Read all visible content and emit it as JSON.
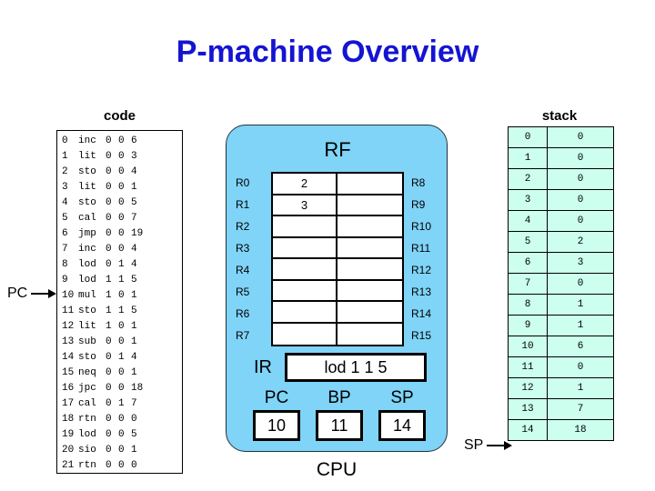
{
  "title": "P-machine Overview",
  "colors": {
    "title": "#1414d2",
    "cpu_panel": "#7FD4F7",
    "stack_cell": "#CCFFEE",
    "box_border": "#000000"
  },
  "code": {
    "label": "code",
    "pointer_label": "PC",
    "pointer_target_line": 10,
    "lines": [
      {
        "n": "0",
        "op": "inc",
        "a": "0",
        "b": "0",
        "c": "6"
      },
      {
        "n": "1",
        "op": "lit",
        "a": "0",
        "b": "0",
        "c": "3"
      },
      {
        "n": "2",
        "op": "sto",
        "a": "0",
        "b": "0",
        "c": "4"
      },
      {
        "n": "3",
        "op": "lit",
        "a": "0",
        "b": "0",
        "c": "1"
      },
      {
        "n": "4",
        "op": "sto",
        "a": "0",
        "b": "0",
        "c": "5"
      },
      {
        "n": "5",
        "op": "cal",
        "a": "0",
        "b": "0",
        "c": "7"
      },
      {
        "n": "6",
        "op": "jmp",
        "a": "0",
        "b": "0",
        "c": "19"
      },
      {
        "n": "7",
        "op": "inc",
        "a": "0",
        "b": "0",
        "c": "4"
      },
      {
        "n": "8",
        "op": "lod",
        "a": "0",
        "b": "1",
        "c": "4"
      },
      {
        "n": "9",
        "op": "lod",
        "a": "1",
        "b": "1",
        "c": "5"
      },
      {
        "n": "10",
        "op": "mul",
        "a": "1",
        "b": "0",
        "c": "1"
      },
      {
        "n": "11",
        "op": "sto",
        "a": "1",
        "b": "1",
        "c": "5"
      },
      {
        "n": "12",
        "op": "lit",
        "a": "1",
        "b": "0",
        "c": "1"
      },
      {
        "n": "13",
        "op": "sub",
        "a": "0",
        "b": "0",
        "c": "1"
      },
      {
        "n": "14",
        "op": "sto",
        "a": "0",
        "b": "1",
        "c": "4"
      },
      {
        "n": "15",
        "op": "neq",
        "a": "0",
        "b": "0",
        "c": "1"
      },
      {
        "n": "16",
        "op": "jpc",
        "a": "0",
        "b": "0",
        "c": "18"
      },
      {
        "n": "17",
        "op": "cal",
        "a": "0",
        "b": "1",
        "c": "7"
      },
      {
        "n": "18",
        "op": "rtn",
        "a": "0",
        "b": "0",
        "c": "0"
      },
      {
        "n": "19",
        "op": "lod",
        "a": "0",
        "b": "0",
        "c": "5"
      },
      {
        "n": "20",
        "op": "sio",
        "a": "0",
        "b": "0",
        "c": "1"
      },
      {
        "n": "21",
        "op": "rtn",
        "a": "0",
        "b": "0",
        "c": "0"
      }
    ]
  },
  "cpu": {
    "caption": "CPU",
    "rf": {
      "title": "RF",
      "labels_left": [
        "R0",
        "R1",
        "R2",
        "R3",
        "R4",
        "R5",
        "R6",
        "R7"
      ],
      "labels_right": [
        "R8",
        "R9",
        "R10",
        "R11",
        "R12",
        "R13",
        "R14",
        "R15"
      ],
      "values_left": [
        "2",
        "3",
        "",
        "",
        "",
        "",
        "",
        ""
      ],
      "values_right": [
        "",
        "",
        "",
        "",
        "",
        "",
        "",
        ""
      ]
    },
    "ir": {
      "label": "IR",
      "value": "lod 1 1 5"
    },
    "registers": [
      {
        "name": "PC",
        "value": "10"
      },
      {
        "name": "BP",
        "value": "11"
      },
      {
        "name": "SP",
        "value": "14"
      }
    ]
  },
  "stack": {
    "label": "stack",
    "pointer_label": "SP",
    "pointer_target_index": 14,
    "rows": [
      {
        "index": "0",
        "value": "0"
      },
      {
        "index": "1",
        "value": "0"
      },
      {
        "index": "2",
        "value": "0"
      },
      {
        "index": "3",
        "value": "0"
      },
      {
        "index": "4",
        "value": "0"
      },
      {
        "index": "5",
        "value": "2"
      },
      {
        "index": "6",
        "value": "3"
      },
      {
        "index": "7",
        "value": "0"
      },
      {
        "index": "8",
        "value": "1"
      },
      {
        "index": "9",
        "value": "1"
      },
      {
        "index": "10",
        "value": "6"
      },
      {
        "index": "11",
        "value": "0"
      },
      {
        "index": "12",
        "value": "1"
      },
      {
        "index": "13",
        "value": "7"
      },
      {
        "index": "14",
        "value": "18"
      }
    ]
  }
}
